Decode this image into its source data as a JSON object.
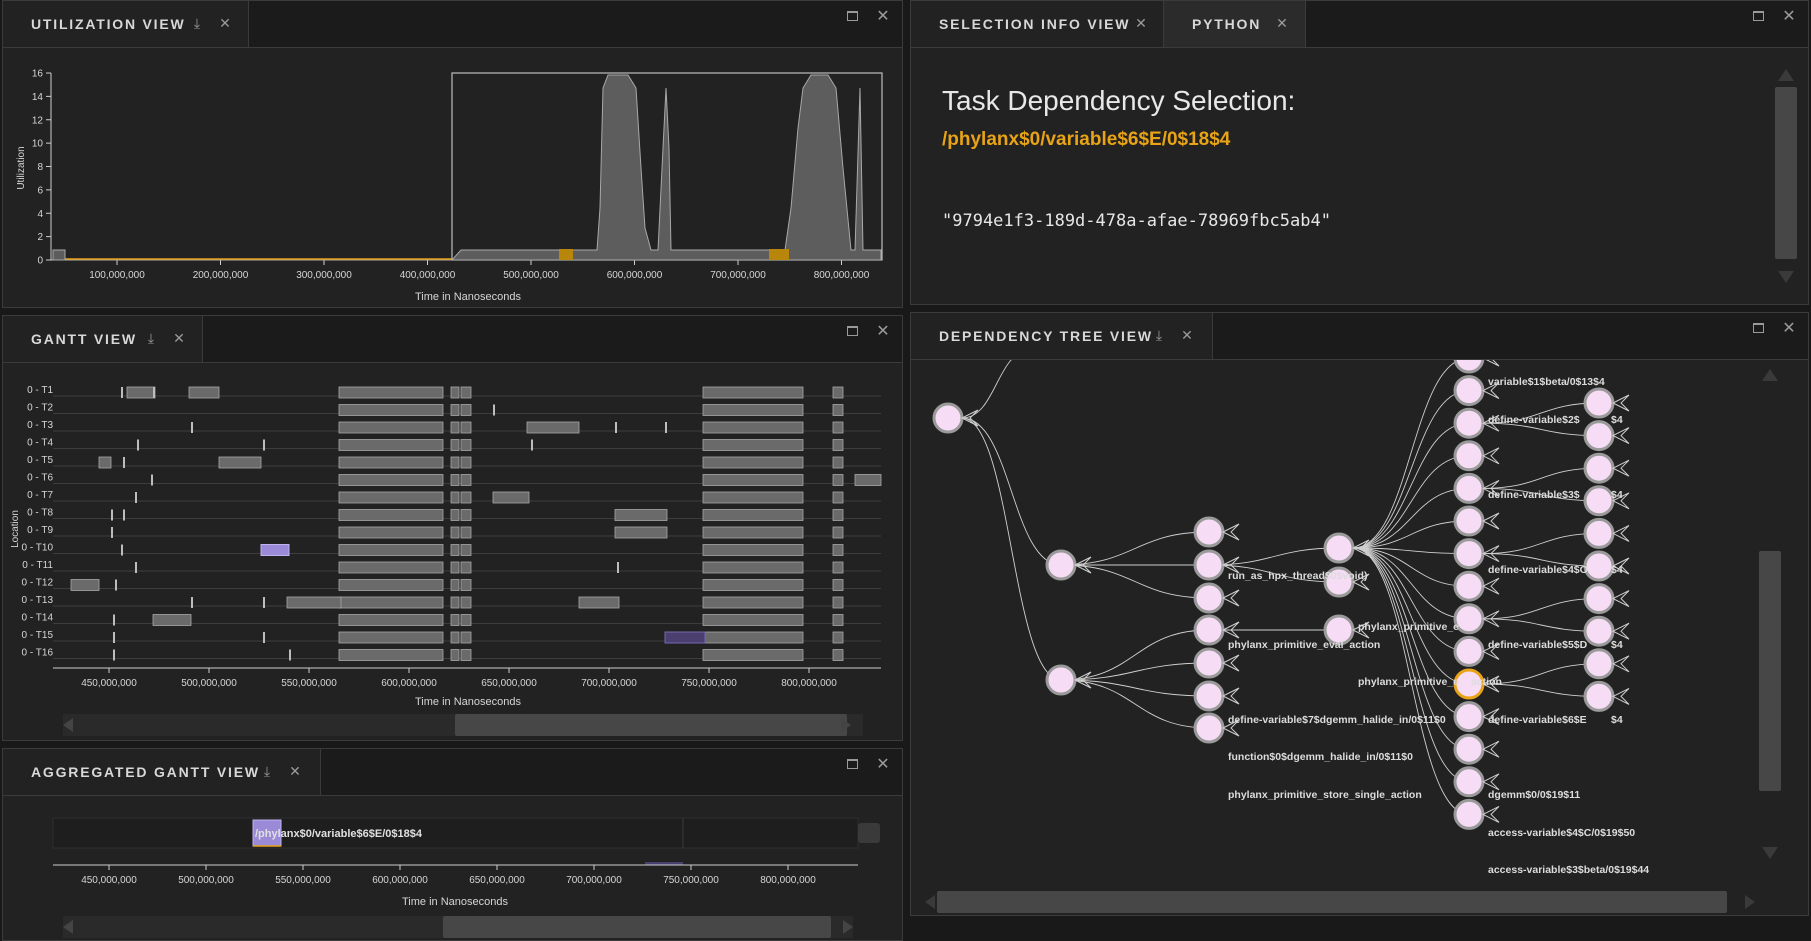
{
  "panels": {
    "utilization": {
      "title": "UTILIZATION VIEW"
    },
    "gantt": {
      "title": "GANTT VIEW"
    },
    "aggregated": {
      "title": "AGGREGATED GANTT VIEW"
    },
    "selection": {
      "title": "SELECTION INFO VIEW"
    },
    "python": {
      "title": "PYTHON"
    },
    "dependency": {
      "title": "DEPENDENCY TREE VIEW"
    }
  },
  "colors": {
    "background": "#191919",
    "panel": "#222222",
    "accent": "#e8a317",
    "node_fill": "#f7dcf6",
    "bar_fill": "#6a6a6a",
    "highlight_bar": "#9a8ad8"
  },
  "utilization": {
    "ylabel": "Utilization",
    "xlabel": "Time in Nanoseconds",
    "yticks": [
      "0",
      "2",
      "4",
      "6",
      "8",
      "10",
      "12",
      "14",
      "16"
    ],
    "xticks": [
      "100,000,000",
      "200,000,000",
      "300,000,000",
      "400,000,000",
      "500,000,000",
      "600,000,000",
      "700,000,000",
      "800,000,000"
    ]
  },
  "gantt": {
    "ylabel": "Location",
    "xlabel": "Time in Nanoseconds",
    "rows": [
      "0 - T1",
      "0 - T2",
      "0 - T3",
      "0 - T4",
      "0 - T5",
      "0 - T6",
      "0 - T7",
      "0 - T8",
      "0 - T9",
      "0 - T10",
      "0 - T11",
      "0 - T12",
      "0 - T13",
      "0 - T14",
      "0 - T15",
      "0 - T16"
    ],
    "xticks": [
      "450,000,000",
      "500,000,000",
      "550,000,000",
      "600,000,000",
      "650,000,000",
      "700,000,000",
      "750,000,000",
      "800,000,000"
    ]
  },
  "aggregated": {
    "label": "/phylanx$0/variable$6$E/0$18$4",
    "xlabel": "Time in Nanoseconds",
    "xticks": [
      "450,000,000",
      "500,000,000",
      "550,000,000",
      "600,000,000",
      "650,000,000",
      "700,000,000",
      "750,000,000",
      "800,000,000"
    ]
  },
  "selection": {
    "heading": "Task Dependency Selection:",
    "name": "/phylanx$0/variable$6$E/0$18$4",
    "guid": "\"9794e1f3-189d-478a-afae-78969fbc5ab4\""
  },
  "tree": {
    "labels": {
      "run_as_hpx": "run_as_hpx_thread$0$void)",
      "prim_eval_action": "phylanx_primitive_eval_action",
      "prim_e1": "phylanx_primitive_e",
      "prim_e2": "phylanx_primitive_e",
      "action_suffix": "action",
      "def7": "define-variable$7$dgemm_halide_in/0$11$0",
      "func0": "function$0$dgemm_halide_in/0$11$0",
      "store_single": "phylanx_primitive_store_single_action",
      "var1beta": "variable$1$beta/0$13$4",
      "def2": "define-variable$2$",
      "def3": "define-variable$3$",
      "def4": "define-variable$4$O",
      "def5": "define-variable$5$D",
      "def6": "define-variable$6$E",
      "suffix4": "$4",
      "dgemm0": "dgemm$0/0$19$11",
      "access4": "access-variable$4$C/0$19$50",
      "access3": "access-variable$3$beta/0$19$44"
    }
  }
}
